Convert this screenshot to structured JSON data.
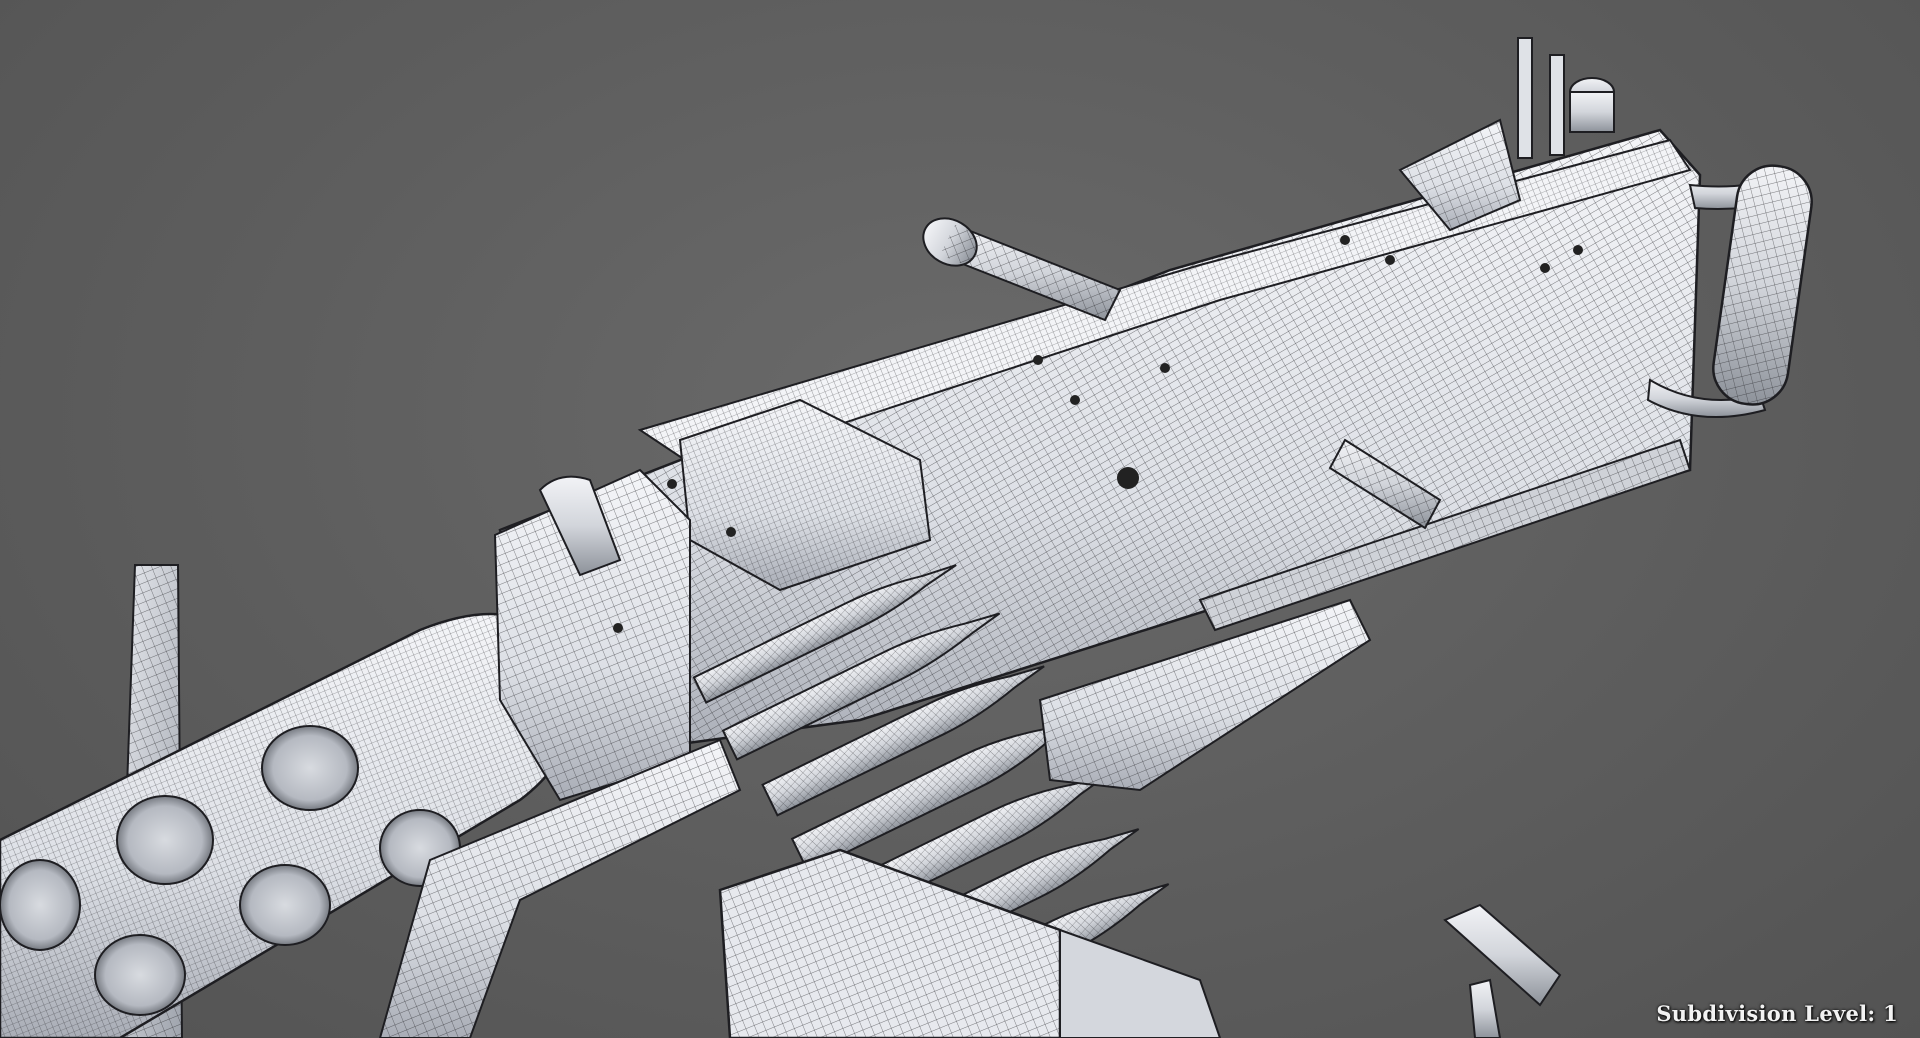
{
  "viewport": {
    "background_color": "#5c5c5c",
    "subject": "wireframe-machine-gun-model",
    "subdivision_label": "Subdivision Level: 1"
  },
  "colors": {
    "surface_light": "#eef0f4",
    "surface_mid": "#c9ccd3",
    "surface_dark": "#8e939c",
    "wire": "#1e1e22"
  }
}
